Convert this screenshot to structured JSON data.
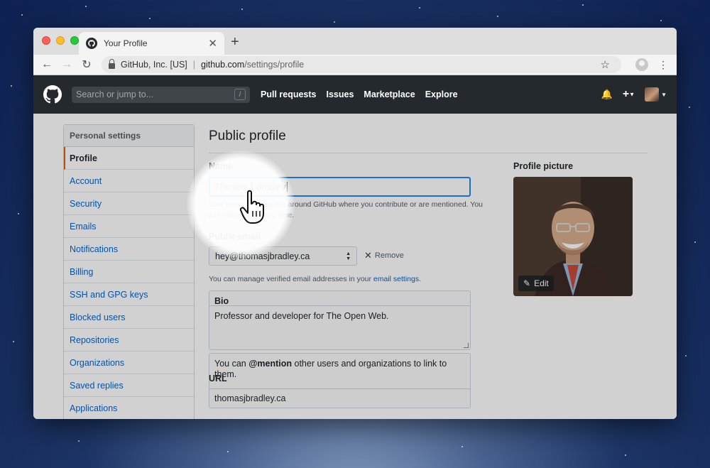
{
  "browser": {
    "tab_title": "Your Profile",
    "new_tab": "+",
    "org": "GitHub, Inc. [US]",
    "url_host": "github.com",
    "url_path": "/settings/profile"
  },
  "header": {
    "search_placeholder": "Search or jump to...",
    "search_shortcut": "/",
    "nav": [
      "Pull requests",
      "Issues",
      "Marketplace",
      "Explore"
    ]
  },
  "sidebar": {
    "heading": "Personal settings",
    "items": [
      {
        "label": "Profile",
        "active": true
      },
      {
        "label": "Account"
      },
      {
        "label": "Security"
      },
      {
        "label": "Emails"
      },
      {
        "label": "Notifications"
      },
      {
        "label": "Billing"
      },
      {
        "label": "SSH and GPG keys"
      },
      {
        "label": "Blocked users"
      },
      {
        "label": "Repositories"
      },
      {
        "label": "Organizations"
      },
      {
        "label": "Saved replies"
      },
      {
        "label": "Applications"
      }
    ]
  },
  "main": {
    "title": "Public profile",
    "name_label": "Name",
    "name_value": "Thomas J Bradley",
    "name_note": "Your name may appear around GitHub where you contribute or are mentioned. You can remove it at any time.",
    "email_label": "Public email",
    "email_value": "hey@thomasjbradley.ca",
    "remove_label": "Remove",
    "email_note_pre": "You can manage verified email addresses in your ",
    "email_note_link": "email settings",
    "email_note_post": ".",
    "bio_label": "Bio",
    "bio_value": "Professor and developer for The Open Web.",
    "bio_note_pre": "You can ",
    "bio_note_mention": "@mention",
    "bio_note_post": " other users and organizations to link to them.",
    "url_label": "URL",
    "url_value": "thomasjbradley.ca",
    "picture_label": "Profile picture",
    "edit_label": "Edit"
  }
}
